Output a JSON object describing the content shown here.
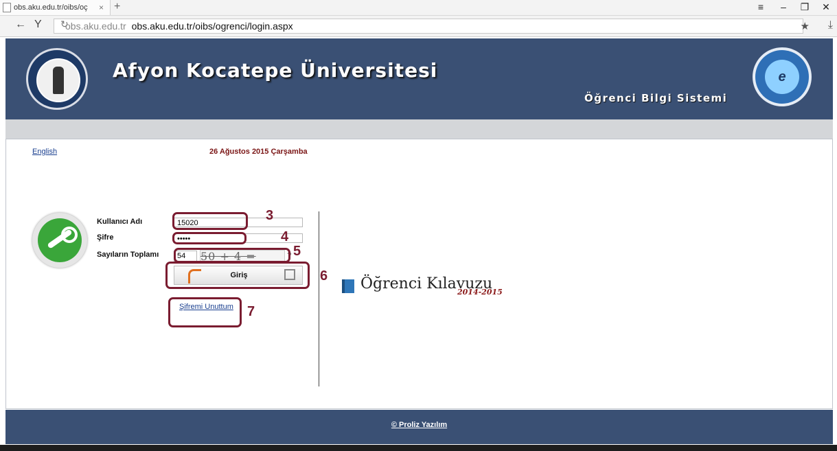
{
  "browser": {
    "tab_title": "obs.aku.edu.tr/oibs/oç",
    "tab_close": "×",
    "new_tab": "+",
    "url_domain": "obs.aku.edu.tr",
    "url_full": "obs.aku.edu.tr/oibs/ogrenci/login.aspx",
    "icons": [
      "back-arrow-icon",
      "y-icon",
      "reload-icon",
      "star-icon",
      "download-icon",
      "menu-icon",
      "minimize-icon",
      "restore-icon",
      "close-icon"
    ]
  },
  "header": {
    "title": "Afyon Kocatepe Üniversitesi",
    "subtitle": "Öğrenci Bilgi Sistemi",
    "badge_letter": "e",
    "bg_color": "#3a5074"
  },
  "topbar": {
    "lang_link": "English",
    "date": "26 Ağustos 2015 Çarşamba"
  },
  "form": {
    "username_label": "Kullanıcı Adı",
    "username_value": "15020",
    "password_label": "Şifre",
    "password_value": "•••••",
    "sum_label": "Sayıların Toplamı",
    "sum_value": "54",
    "captcha_text": "50 + 4 =",
    "refresh_icon": "?",
    "login_button": "Giriş",
    "forgot_link": "Şifremi Unuttum"
  },
  "guide": {
    "title": "Öğrenci Kılavuzu",
    "year": "2014-2015"
  },
  "annotations": [
    "3",
    "4",
    "5",
    "6",
    "7"
  ],
  "annotation_color": "#7a1c30",
  "footer": {
    "link": "© Proliz Yazılım"
  }
}
